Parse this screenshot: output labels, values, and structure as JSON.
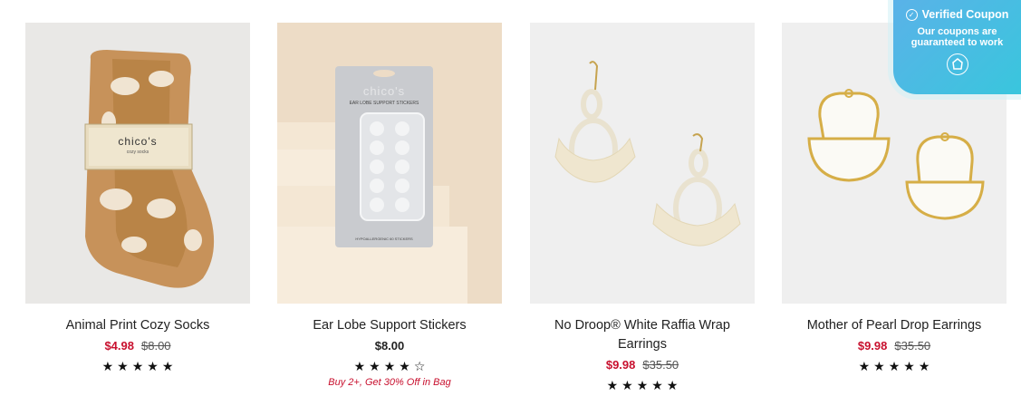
{
  "products": [
    {
      "title": "Animal Print Cozy Socks",
      "sale_price": "$4.98",
      "original_price": "$8.00",
      "rating": 5,
      "stars": "★★★★★",
      "image_label": "chico's",
      "image_sublabel": "cozy socks"
    },
    {
      "title": "Ear Lobe Support Stickers",
      "price": "$8.00",
      "rating": 4,
      "stars": "★★★★☆",
      "promo": "Buy 2+, Get 30% Off in Bag",
      "image_label": "chico's",
      "image_sublabel": "EAR LOBE SUPPORT STICKERS",
      "image_footer": "HYPOALLERGENIC  60 STICKERS"
    },
    {
      "title_line1": "No Droop® White Raffia Wrap",
      "title_line2": "Earrings",
      "sale_price": "$9.98",
      "original_price": "$35.50",
      "rating": 5,
      "stars": "★★★★★"
    },
    {
      "title": "Mother of Pearl Drop Earrings",
      "sale_price": "$9.98",
      "original_price": "$35.50",
      "rating": 5,
      "stars": "★★★★★"
    }
  ],
  "coupon": {
    "title": "Verified Coupon",
    "line1": "Our coupons are",
    "line2": "guaranteed to work",
    "icon": "shield-logo-icon"
  },
  "colors": {
    "sale": "#c8102e",
    "coupon_bg": "#48bde3"
  }
}
